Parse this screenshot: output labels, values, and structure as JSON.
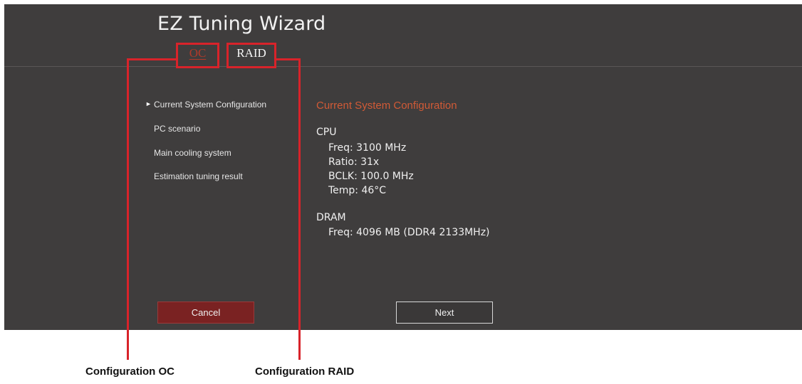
{
  "window": {
    "title": "EZ Tuning Wizard"
  },
  "tabs": [
    {
      "label": "OC",
      "active": true
    },
    {
      "label": "RAID",
      "active": false
    }
  ],
  "nav": {
    "items": [
      {
        "label": "Current System Configuration",
        "selected": true
      },
      {
        "label": "PC scenario",
        "selected": false
      },
      {
        "label": "Main cooling system",
        "selected": false
      },
      {
        "label": "Estimation tuning result",
        "selected": false
      }
    ]
  },
  "panel": {
    "title": "Current System Configuration",
    "cpu": {
      "heading": "CPU",
      "lines": [
        "Freq: 3100 MHz",
        "Ratio: 31x",
        "BCLK: 100.0 MHz",
        "Temp: 46°C"
      ]
    },
    "dram": {
      "heading": "DRAM",
      "lines": [
        "Freq: 4096 MB (DDR4 2133MHz)"
      ]
    }
  },
  "buttons": {
    "cancel": "Cancel",
    "next": "Next"
  },
  "annotations": {
    "oc_caption": "Configuration OC",
    "raid_caption": "Configuration RAID"
  },
  "colors": {
    "background": "#3f3d3d",
    "accent": "#d15a36",
    "callout": "#d8232a",
    "cancel_button": "#7a2222"
  },
  "icons": {
    "nav_selected": "triangle-right-icon"
  }
}
